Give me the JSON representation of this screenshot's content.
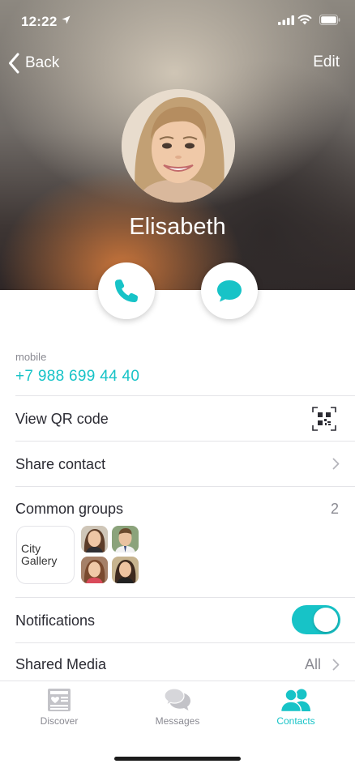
{
  "status_bar": {
    "time": "12:22"
  },
  "nav": {
    "back_label": "Back",
    "edit_label": "Edit"
  },
  "contact": {
    "name": "Elisabeth"
  },
  "phone": {
    "label": "mobile",
    "number": "+7 988 699 44 40"
  },
  "rows": {
    "qr_label": "View QR code",
    "share_label": "Share contact",
    "groups_label": "Common groups",
    "groups_count": "2",
    "notifications_label": "Notifications",
    "notifications_enabled": true,
    "media_label": "Shared Media",
    "media_filter": "All"
  },
  "groups": {
    "city_gallery_label": "City Gallery"
  },
  "tabs": [
    {
      "label": "Discover",
      "icon": "discover-icon",
      "active": false
    },
    {
      "label": "Messages",
      "icon": "messages-icon",
      "active": false
    },
    {
      "label": "Contacts",
      "icon": "contacts-icon",
      "active": true
    }
  ],
  "colors": {
    "accent": "#17c3c7",
    "text": "#2b2b33",
    "muted": "#8a8a92",
    "divider": "#e4e4e8"
  }
}
